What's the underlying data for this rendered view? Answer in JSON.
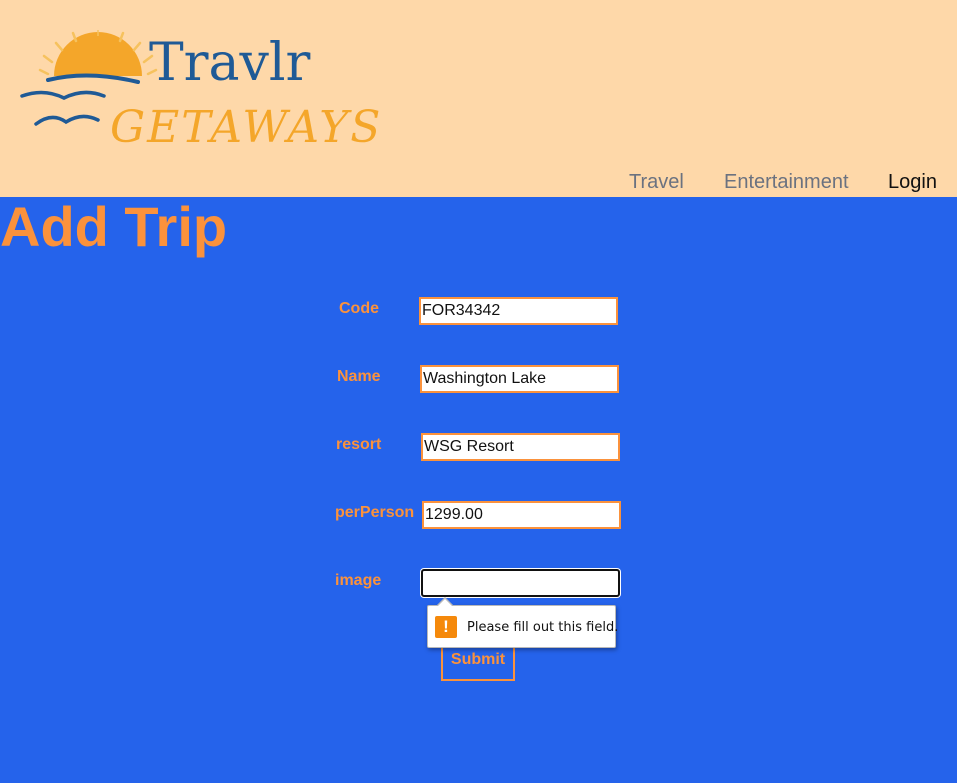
{
  "brand": {
    "logo_text_top": "Travlr",
    "logo_text_bottom": "GETAWAYS",
    "colors": {
      "header_bg": "#fed8a9",
      "logo_blue": "#1f5a96",
      "logo_orange": "#f4a62a"
    }
  },
  "nav": {
    "items": [
      {
        "label": "Travel"
      },
      {
        "label": "Entertainment"
      },
      {
        "label": "Login"
      }
    ]
  },
  "page": {
    "title": "Add Trip",
    "background_color": "#2563eb",
    "accent_color": "#fb923c"
  },
  "form": {
    "fields": [
      {
        "label": "Code",
        "value": "FOR34342"
      },
      {
        "label": "Name",
        "value": "Washington Lake"
      },
      {
        "label": "resort",
        "value": "WSG Resort"
      },
      {
        "label": "perPerson",
        "value": "1299.00"
      },
      {
        "label": "image",
        "value": ""
      }
    ],
    "submit_label": "Submit",
    "validation": {
      "icon": "warning-icon",
      "icon_glyph": "!",
      "message": "Please fill out this field."
    }
  }
}
